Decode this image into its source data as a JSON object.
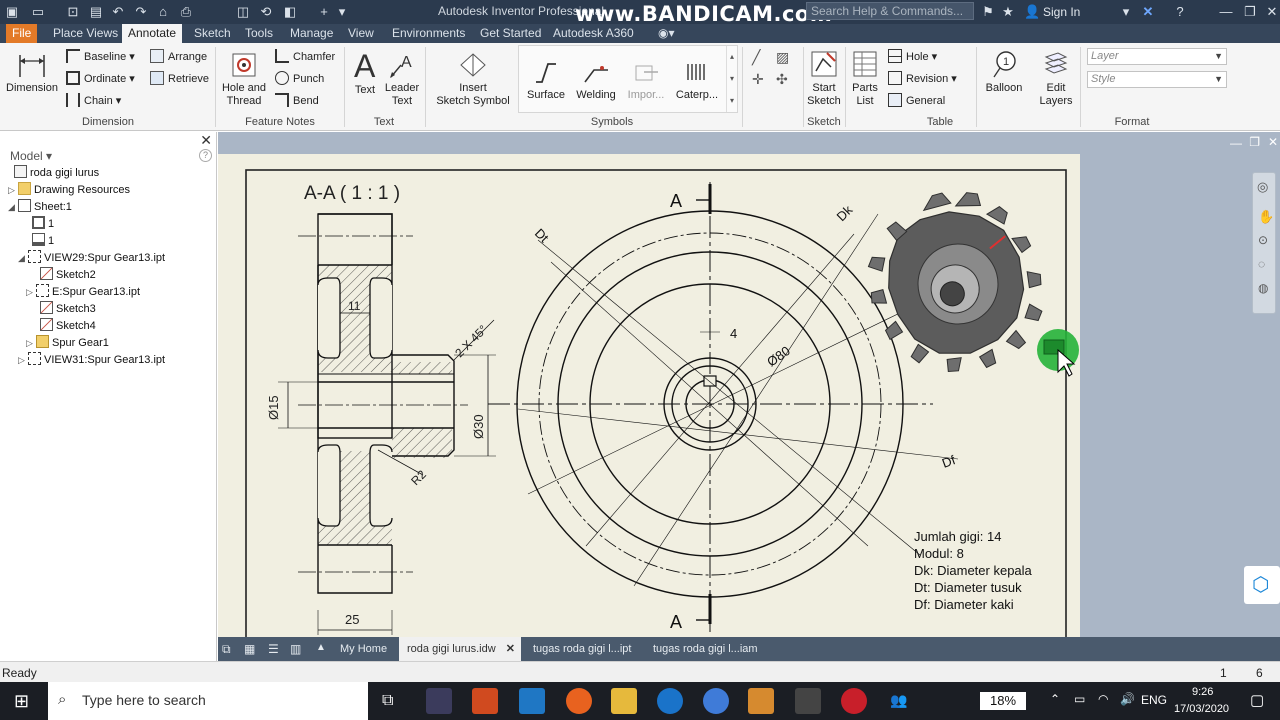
{
  "titlebar": {
    "app_title": "Autodesk Inventor Professional",
    "watermark": "www.BANDICAM.com",
    "search_placeholder": "Search Help & Commands...",
    "signin": "Sign In"
  },
  "menu_tabs": [
    "File",
    "Place Views",
    "Annotate",
    "Sketch",
    "Tools",
    "Manage",
    "View",
    "Environments",
    "Get Started",
    "Autodesk A360"
  ],
  "ribbon": {
    "dimension": {
      "title": "Dimension",
      "big": "Dimension",
      "baseline": "Baseline",
      "ordinate": "Ordinate",
      "chain": "Chain",
      "arrange": "Arrange",
      "retrieve": "Retrieve"
    },
    "feature_notes": {
      "title": "Feature Notes",
      "hole_line1": "Hole and",
      "hole_line2": "Thread",
      "chamfer": "Chamfer",
      "punch": "Punch",
      "bend": "Bend"
    },
    "text": {
      "title": "Text",
      "text": "Text",
      "leader_line1": "Leader",
      "leader_line2": "Text"
    },
    "symbols": {
      "title": "Symbols",
      "insert_line1": "Insert",
      "insert_line2": "Sketch Symbol",
      "surface": "Surface",
      "welding": "Welding",
      "import": "Impor...",
      "caterpillar": "Caterp..."
    },
    "sketch": {
      "title": "Sketch",
      "start_line1": "Start",
      "start_line2": "Sketch"
    },
    "table": {
      "title": "Table",
      "parts_line1": "Parts",
      "parts_line2": "List",
      "hole": "Hole",
      "revision": "Revision",
      "general": "General"
    },
    "format": {
      "title": "Format",
      "balloon": "Balloon",
      "edit_line1": "Edit",
      "edit_line2": "Layers",
      "layer_placeholder": "Layer",
      "style_placeholder": "Style"
    }
  },
  "browser": {
    "header": "Model",
    "items": [
      "roda gigi lurus",
      "Drawing Resources",
      "Sheet:1",
      "1",
      "1",
      "VIEW29:Spur Gear13.ipt",
      "Sketch2",
      "E:Spur Gear13.ipt",
      "Sketch3",
      "Sketch4",
      "Spur Gear1",
      "VIEW31:Spur Gear13.ipt"
    ]
  },
  "drawing": {
    "section_title": "A-A ( 1 : 1 )",
    "dims": {
      "d15": "Ø15",
      "d30": "Ø30",
      "d80": "Ø80",
      "w11": "11",
      "w25": "25",
      "chamfer": "2 X 45°",
      "r2": "R2",
      "key4": "4"
    },
    "leaders": {
      "dk": "Dk",
      "dt": "Dt",
      "df": "Df"
    },
    "cut_label": "A",
    "notes": [
      "Jumlah gigi: 14",
      "Modul: 8",
      "Dk: Diameter kepala",
      "Dt: Diameter tusuk",
      "Df: Diameter kaki"
    ]
  },
  "doc_tabs": [
    "My Home",
    "roda gigi lurus.idw",
    "tugas roda gigi l...ipt",
    "tugas roda gigi l...iam"
  ],
  "status": {
    "text": "Ready",
    "count1": "1",
    "count2": "6"
  },
  "taskbar": {
    "search_placeholder": "Type here to search",
    "battery": "18%",
    "lang": "ENG",
    "time": "9:26",
    "date": "17/03/2020"
  },
  "colors": {
    "accent_file": "#e37a28",
    "titlebar": "#2b3a4e",
    "sheet": "#f1efe1",
    "canvas": "#aab6c6"
  }
}
